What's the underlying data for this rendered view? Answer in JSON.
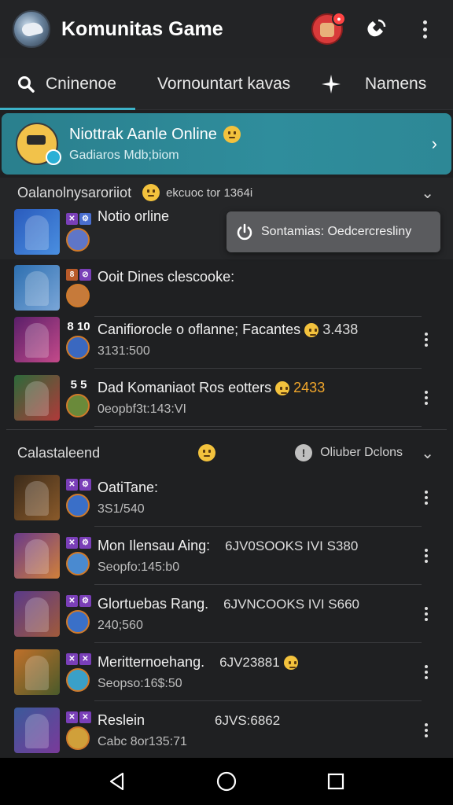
{
  "app": {
    "title": "Komunitas Game"
  },
  "appbar": {
    "notif_count": ""
  },
  "tabs": [
    {
      "label": "Cninenoe",
      "icon": "search-icon"
    },
    {
      "label": "Vornountart kavas"
    },
    {
      "label": "Namens",
      "icon": "sparkle-icon"
    }
  ],
  "highlight": {
    "title": "Niottrak Aanle Online",
    "subtitle": "Gadiaros Mdb;biom"
  },
  "section1": {
    "label": "Oalanolnysaroriiot",
    "meta": "ekcuoc tor 1364i"
  },
  "toast": {
    "text": "Sontamias: Oedcercresliny"
  },
  "online_list": [
    {
      "badge": "",
      "title": "Notio orline",
      "extra": "",
      "extra_value": "",
      "subtitle": ""
    },
    {
      "badge": "8",
      "title": "Ooit Dines clescooke:",
      "extra": "",
      "extra_value": "",
      "subtitle": ""
    },
    {
      "badge": "8 10",
      "title": "Canifiorocle o oflanne; Facantes",
      "extra": "",
      "extra_value": "3.438",
      "subtitle": "3131:500"
    },
    {
      "badge": "5 5",
      "title": "Dad Komaniaot Ros eotters",
      "extra": "",
      "extra_value": "2433",
      "subtitle": "0eopbf3t:143:VI"
    }
  ],
  "section2": {
    "label": "Calastaleend",
    "right_label": "Oliuber Dclons"
  },
  "list2": [
    {
      "title": "OatiTane:",
      "extra": "",
      "subtitle": "3S1/540"
    },
    {
      "title": "Mon Ilensau Aing:",
      "extra": "6JV0SOOKS IVI S380",
      "subtitle": "Seopfo:145:b0"
    },
    {
      "title": "Glortuebas Rang.",
      "extra": "6JVNCOOKS IVI S660",
      "subtitle": "240;560"
    },
    {
      "title": "Meritternoehang.",
      "extra": "6JV23881",
      "subtitle": "Seopso:16$:50"
    },
    {
      "title": "Reslein",
      "extra": "6JVS:6862",
      "subtitle": "Cabc 8or135:71"
    }
  ],
  "colors": {
    "accent": "#3cb2c8",
    "highlight_bg": "#2d8896",
    "background": "#1f2022",
    "orange_value": "#f1a62b"
  }
}
